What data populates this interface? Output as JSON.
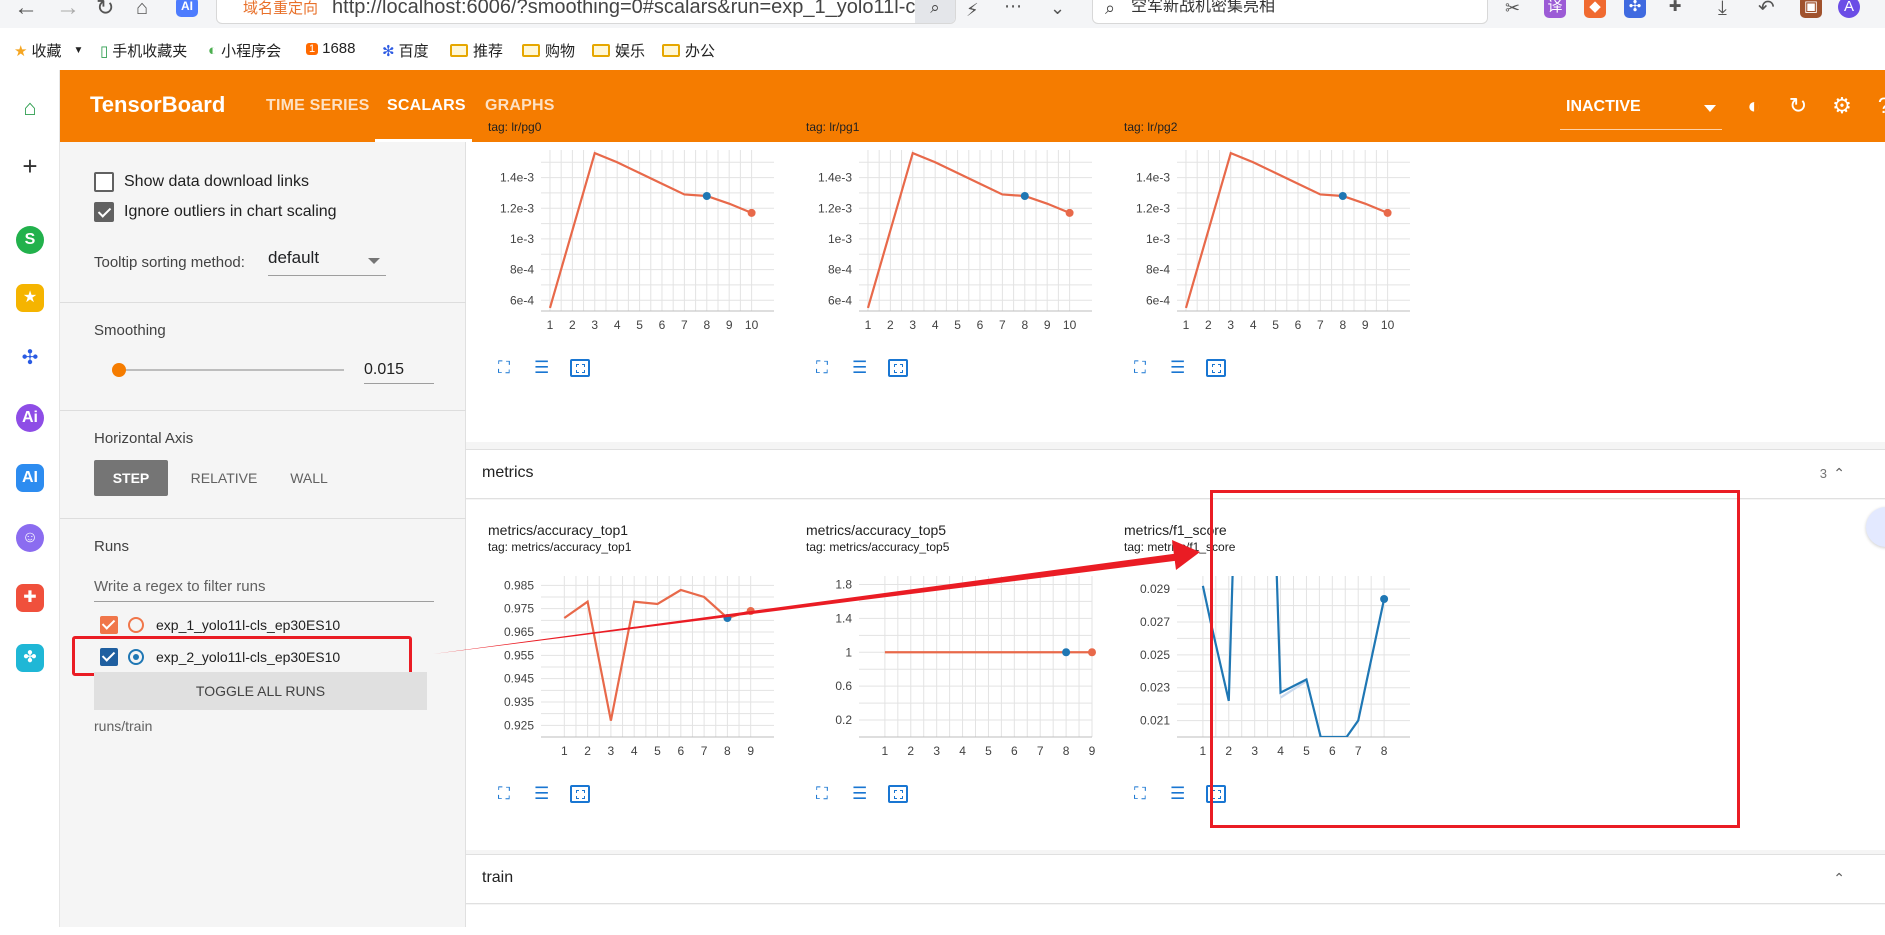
{
  "browser": {
    "redirect_label": "域名重定向",
    "url": "http://localhost:6006/?smoothing=0#scalars&run=exp_1_yolo11l-cls_e",
    "search_text": "空军新战机密集亮相",
    "ai_badge": "AI"
  },
  "bookmarks": [
    {
      "label": "收藏"
    },
    {
      "label": "手机收藏夹"
    },
    {
      "label": "小程序会"
    },
    {
      "label": "1688"
    },
    {
      "label": "百度"
    },
    {
      "label": "推荐"
    },
    {
      "label": "购物"
    },
    {
      "label": "娱乐"
    },
    {
      "label": "办公"
    }
  ],
  "header": {
    "logo": "TensorBoard",
    "tabs": [
      {
        "label": "TIME SERIES",
        "active": false
      },
      {
        "label": "SCALARS",
        "active": true
      },
      {
        "label": "GRAPHS",
        "active": false
      }
    ],
    "status": "INACTIVE"
  },
  "sidebar": {
    "show_download": {
      "label": "Show data download links",
      "checked": false
    },
    "ignore_outliers": {
      "label": "Ignore outliers in chart scaling",
      "checked": true
    },
    "tooltip_label": "Tooltip sorting method:",
    "tooltip_value": "default",
    "smoothing_label": "Smoothing",
    "smoothing_value": "0.015",
    "smoothing_fraction": 0.015,
    "haxis_label": "Horizontal Axis",
    "haxis_options": [
      {
        "label": "STEP",
        "active": true
      },
      {
        "label": "RELATIVE",
        "active": false
      },
      {
        "label": "WALL",
        "active": false
      }
    ],
    "runs_label": "Runs",
    "regex_placeholder": "Write a regex to filter runs",
    "runs": [
      {
        "name": "exp_1_yolo11l-cls_ep30ES10",
        "color": "#f0764a",
        "checked": true,
        "selected": false
      },
      {
        "name": "exp_2_yolo11l-cls_ep30ES10",
        "color": "#1f77b4",
        "checked": true,
        "selected": true
      }
    ],
    "toggle_label": "TOGGLE ALL RUNS",
    "runs_path": "runs/train"
  },
  "sections": {
    "metrics": {
      "title": "metrics",
      "count": "3"
    },
    "train": {
      "title": "train"
    }
  },
  "colors": {
    "accent": "#f57c00",
    "series_orange": "#e8694a",
    "series_blue": "#1f77b4",
    "annotation_red": "#ea1c24"
  },
  "charts": [
    {
      "title": "",
      "tag": "tag: lr/pg0"
    },
    {
      "title": "",
      "tag": "tag: lr/pg1"
    },
    {
      "title": "",
      "tag": "tag: lr/pg2"
    },
    {
      "title": "metrics/accuracy_top1",
      "tag": "tag: metrics/accuracy_top1"
    },
    {
      "title": "metrics/accuracy_top5",
      "tag": "tag: metrics/accuracy_top5"
    },
    {
      "title": "metrics/f1_score",
      "tag": "tag: metrics/f1_score"
    }
  ],
  "chart_data": [
    {
      "type": "line",
      "tag": "tag: lr/pg0",
      "x_ticks": [
        "1",
        "2",
        "3",
        "4",
        "5",
        "6",
        "7",
        "8",
        "9",
        "10"
      ],
      "y_ticks": [
        "6e-4",
        "8e-4",
        "1e-3",
        "1.2e-3",
        "1.4e-3"
      ],
      "xlim": [
        0.6,
        11
      ],
      "ylim": [
        0.00053,
        0.00158
      ],
      "series": [
        {
          "color": "#e8694a",
          "x": [
            1,
            3,
            4,
            5,
            6,
            7,
            8,
            9,
            10
          ],
          "y": [
            0.00055,
            0.00156,
            0.0015,
            0.00143,
            0.00136,
            0.00129,
            0.00128,
            0.00123,
            0.00117
          ]
        }
      ],
      "markers": [
        {
          "x": 8,
          "y": 0.00128,
          "color": "#1f77b4"
        },
        {
          "x": 10,
          "y": 0.00117,
          "color": "#e8694a"
        }
      ]
    },
    {
      "type": "line",
      "tag": "tag: lr/pg1",
      "x_ticks": [
        "1",
        "2",
        "3",
        "4",
        "5",
        "6",
        "7",
        "8",
        "9",
        "10"
      ],
      "y_ticks": [
        "6e-4",
        "8e-4",
        "1e-3",
        "1.2e-3",
        "1.4e-3"
      ],
      "xlim": [
        0.6,
        11
      ],
      "ylim": [
        0.00053,
        0.00158
      ],
      "series": [
        {
          "color": "#e8694a",
          "x": [
            1,
            3,
            4,
            5,
            6,
            7,
            8,
            9,
            10
          ],
          "y": [
            0.00055,
            0.00156,
            0.0015,
            0.00143,
            0.00136,
            0.00129,
            0.00128,
            0.00123,
            0.00117
          ]
        }
      ],
      "markers": [
        {
          "x": 8,
          "y": 0.00128,
          "color": "#1f77b4"
        },
        {
          "x": 10,
          "y": 0.00117,
          "color": "#e8694a"
        }
      ]
    },
    {
      "type": "line",
      "tag": "tag: lr/pg2",
      "x_ticks": [
        "1",
        "2",
        "3",
        "4",
        "5",
        "6",
        "7",
        "8",
        "9",
        "10"
      ],
      "y_ticks": [
        "6e-4",
        "8e-4",
        "1e-3",
        "1.2e-3",
        "1.4e-3"
      ],
      "xlim": [
        0.6,
        11
      ],
      "ylim": [
        0.00053,
        0.00158
      ],
      "series": [
        {
          "color": "#e8694a",
          "x": [
            1,
            3,
            4,
            5,
            6,
            7,
            8,
            9,
            10
          ],
          "y": [
            0.00055,
            0.00156,
            0.0015,
            0.00143,
            0.00136,
            0.00129,
            0.00128,
            0.00123,
            0.00117
          ]
        }
      ],
      "markers": [
        {
          "x": 8,
          "y": 0.00128,
          "color": "#1f77b4"
        },
        {
          "x": 10,
          "y": 0.00117,
          "color": "#e8694a"
        }
      ]
    },
    {
      "type": "line",
      "title": "metrics/accuracy_top1",
      "tag": "tag: metrics/accuracy_top1",
      "x_ticks": [
        "1",
        "2",
        "3",
        "4",
        "5",
        "6",
        "7",
        "8",
        "9"
      ],
      "y_ticks": [
        "0.925",
        "0.935",
        "0.945",
        "0.955",
        "0.965",
        "0.975",
        "0.985"
      ],
      "xlim": [
        0.0,
        10.0
      ],
      "ylim": [
        0.92,
        0.989
      ],
      "series": [
        {
          "color": "#e8694a",
          "x": [
            1,
            2,
            3,
            4,
            5,
            6,
            7,
            8,
            9
          ],
          "y": [
            0.971,
            0.978,
            0.927,
            0.978,
            0.977,
            0.983,
            0.98,
            0.971,
            0.974
          ]
        }
      ],
      "markers": [
        {
          "x": 8,
          "y": 0.971,
          "color": "#1f77b4"
        },
        {
          "x": 9,
          "y": 0.974,
          "color": "#e8694a"
        }
      ]
    },
    {
      "type": "line",
      "title": "metrics/accuracy_top5",
      "tag": "tag: metrics/accuracy_top5",
      "x_ticks": [
        "1",
        "2",
        "3",
        "4",
        "5",
        "6",
        "7",
        "8",
        "9"
      ],
      "y_ticks": [
        "0.2",
        "0.6",
        "1",
        "1.4",
        "1.8"
      ],
      "xlim": [
        0.0,
        9.0
      ],
      "ylim": [
        0.0,
        1.9
      ],
      "series": [
        {
          "color": "#e8694a",
          "x": [
            1,
            8,
            9
          ],
          "y": [
            1,
            1,
            1
          ]
        }
      ],
      "markers": [
        {
          "x": 8,
          "y": 1,
          "color": "#1f77b4"
        },
        {
          "x": 9,
          "y": 1,
          "color": "#e8694a"
        }
      ]
    },
    {
      "type": "line",
      "title": "metrics/f1_score",
      "tag": "tag: metrics/f1_score",
      "x_ticks": [
        "1",
        "2",
        "3",
        "4",
        "5",
        "6",
        "7",
        "8"
      ],
      "y_ticks": [
        "0.021",
        "0.023",
        "0.025",
        "0.027",
        "0.029"
      ],
      "xlim": [
        0.0,
        9.0
      ],
      "ylim": [
        0.02,
        0.0298
      ],
      "series": [
        {
          "color": "#c9d9ee",
          "x": [
            4,
            5
          ],
          "y": [
            0.0224,
            0.0234
          ]
        },
        {
          "color": "#1f77b4",
          "x": [
            1,
            1.3,
            2,
            2.15,
            3.85,
            4,
            5,
            5.55,
            6.55,
            7,
            8
          ],
          "y": [
            0.0292,
            0.027,
            0.0222,
            0.03,
            0.03,
            0.0227,
            0.0235,
            0.02,
            0.02,
            0.021,
            0.0284
          ]
        }
      ],
      "markers": [
        {
          "x": 8,
          "y": 0.0284,
          "color": "#1f77b4"
        }
      ]
    }
  ]
}
